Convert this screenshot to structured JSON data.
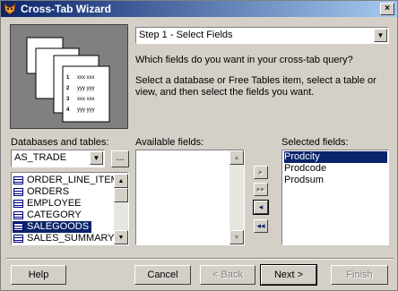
{
  "window": {
    "title": "Cross-Tab Wizard",
    "close_glyph": "×"
  },
  "step_combo": {
    "value": "Step 1 - Select Fields"
  },
  "question": "Which fields do you want in your cross-tab query?",
  "instructions": "Select a database or Free Tables item, select a table or view, and then select the fields you want.",
  "databases": {
    "label": "Databases and tables:",
    "value": "AS_TRADE",
    "browse_label": "...",
    "tables": [
      {
        "label": "ORDER_LINE_ITEM",
        "type": "table"
      },
      {
        "label": "ORDERS",
        "type": "table"
      },
      {
        "label": "EMPLOYEE",
        "type": "table"
      },
      {
        "label": "CATEGORY",
        "type": "table"
      },
      {
        "label": "SALEGOODS",
        "type": "table",
        "selected": true
      },
      {
        "label": "SALES_SUMMARY",
        "type": "view"
      }
    ]
  },
  "available_fields": {
    "label": "Available fields:",
    "items": []
  },
  "selected_fields": {
    "label": "Selected fields:",
    "items": [
      {
        "label": "Prodcity",
        "selected": true
      },
      {
        "label": "Prodcode"
      },
      {
        "label": "Prodsum"
      }
    ]
  },
  "move_buttons": {
    "add": "▸",
    "add_all": "▸▸",
    "remove": "◂",
    "remove_all": "◂◂"
  },
  "buttons": {
    "help": "Help",
    "cancel": "Cancel",
    "back": "< Back",
    "next": "Next >",
    "finish": "Finish"
  },
  "picture_rows": [
    {
      "n": "1",
      "t": "xxx xxx"
    },
    {
      "n": "2",
      "t": "yyy yyy"
    },
    {
      "n": "3",
      "t": "xxx xxx"
    },
    {
      "n": "4",
      "t": "yyy yyy"
    }
  ],
  "colors": {
    "title_start": "#0a246a",
    "title_end": "#a6caf0",
    "selection": "#0a246a",
    "face": "#d4d0c8"
  }
}
